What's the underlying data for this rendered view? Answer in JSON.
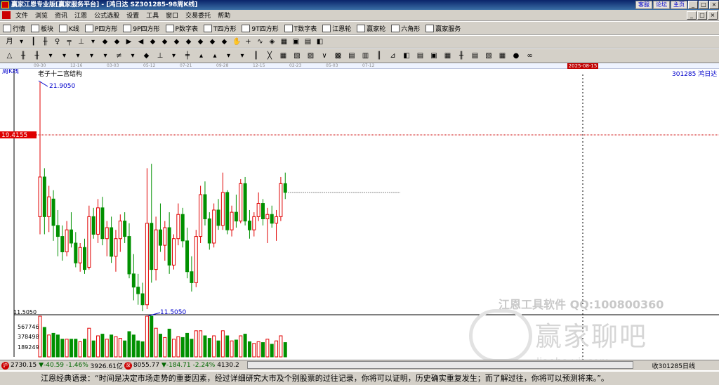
{
  "window": {
    "title": "赢家江恩专业版[赢家服务平台] - [鸿日达  SZ301285-98周K线]",
    "links": [
      "客服",
      "论坛",
      "主页"
    ],
    "controls": [
      "_",
      "□",
      "×"
    ]
  },
  "menu": [
    "文件",
    "浏览",
    "资讯",
    "江恩",
    "公式选股",
    "设置",
    "工具",
    "窗口",
    "交易委托",
    "帮助"
  ],
  "toolbar_main": [
    {
      "label": "行情",
      "icon": "grid-icon"
    },
    {
      "label": "板块",
      "icon": "blocks-icon"
    },
    {
      "label": "K线",
      "icon": "kline-icon"
    },
    {
      "label": "P四方形",
      "icon": "square-p-icon"
    },
    {
      "label": "9P四方形",
      "icon": "square-9p-icon"
    },
    {
      "label": "P数字表",
      "icon": "table-p-icon"
    },
    {
      "label": "T四方形",
      "icon": "square-t-icon"
    },
    {
      "label": "9T四方形",
      "icon": "square-9t-icon"
    },
    {
      "label": "T数字表",
      "icon": "table-t-icon"
    },
    {
      "label": "江恩轮",
      "icon": "wheel-icon"
    },
    {
      "label": "赢家轮",
      "icon": "wheel2-icon"
    },
    {
      "label": "六角形",
      "icon": "hexagon-icon"
    },
    {
      "label": "赢家服务",
      "icon": "service-icon"
    }
  ],
  "date_axis": [
    "09-30",
    "12-16",
    "03-03",
    "05-12",
    "07-21",
    "09-28",
    "12-15",
    "02-23",
    "05-03",
    "07-12"
  ],
  "selected_date": "2025-08-15",
  "chart_label": "周K线",
  "stock_label": "301285  鸿日达",
  "structure_label": "老子十二宫结构",
  "price_high": "21.9050",
  "price_low": "11.5050",
  "price_marker": "19.4155",
  "axis_low_label": "11.5050",
  "volume_labels": [
    "567746",
    "378498",
    "189249"
  ],
  "watermark": {
    "line1": "江恩工具软件  QQ:100800360",
    "line2": "赢家聊吧",
    "line3": "liaoba.yjj.com"
  },
  "status": {
    "sh_value": "2730.15",
    "sh_change": "-40.59",
    "sh_pct": "-1.46%",
    "sh_amount": "3926.61亿",
    "sz_value": "8055.77",
    "sz_change": "-184.71",
    "sz_pct": "-2.24%",
    "sz_amount": "4130.2",
    "right_text": "收301285日线"
  },
  "footer_text": "江恩经典语录：“时间是决定市场走势的重要因素，经过详细研究大市及个别股票的过往记录，你将可以证明，历史确实重复发生；而了解过往，你将可以预测将来。”。",
  "chart_data": {
    "type": "candlestick",
    "title": "周K线",
    "price_range": [
      11.505,
      21.905
    ],
    "candles_ohlc": [
      [
        15.8,
        21.905,
        15.0,
        17.6
      ],
      [
        17.6,
        18.0,
        15.0,
        15.8
      ],
      [
        15.8,
        17.2,
        15.1,
        16.7
      ],
      [
        16.6,
        17.0,
        14.7,
        15.4
      ],
      [
        15.4,
        16.1,
        14.0,
        14.9
      ],
      [
        14.9,
        15.4,
        13.8,
        14.2
      ],
      [
        14.2,
        15.6,
        14.0,
        15.2
      ],
      [
        15.2,
        16.0,
        14.4,
        14.6
      ],
      [
        14.6,
        15.1,
        13.5,
        13.7
      ],
      [
        13.7,
        14.6,
        13.3,
        14.4
      ],
      [
        14.4,
        14.8,
        13.2,
        13.4
      ],
      [
        13.5,
        16.3,
        13.4,
        15.8
      ],
      [
        15.8,
        16.2,
        14.8,
        15.0
      ],
      [
        15.0,
        16.6,
        14.6,
        16.2
      ],
      [
        16.2,
        16.7,
        14.5,
        14.8
      ],
      [
        14.8,
        15.6,
        14.0,
        15.3
      ],
      [
        15.3,
        15.8,
        13.7,
        14.0
      ],
      [
        14.0,
        15.2,
        13.3,
        14.8
      ],
      [
        14.8,
        15.9,
        14.2,
        15.6
      ],
      [
        15.6,
        16.0,
        14.6,
        14.9
      ],
      [
        14.9,
        15.5,
        13.0,
        13.2
      ],
      [
        13.2,
        14.1,
        12.0,
        12.6
      ],
      [
        12.6,
        13.2,
        11.8,
        12.3
      ],
      [
        12.3,
        12.8,
        11.505,
        11.8
      ],
      [
        11.8,
        18.0,
        11.6,
        15.5
      ],
      [
        15.5,
        18.2,
        12.8,
        13.4
      ],
      [
        13.4,
        15.8,
        12.9,
        15.2
      ],
      [
        15.2,
        16.4,
        14.2,
        14.5
      ],
      [
        14.5,
        15.6,
        13.8,
        15.3
      ],
      [
        15.3,
        16.0,
        13.2,
        13.6
      ],
      [
        13.6,
        15.0,
        13.4,
        14.8
      ],
      [
        14.8,
        16.4,
        14.5,
        15.9
      ],
      [
        15.9,
        16.2,
        14.4,
        14.7
      ],
      [
        14.7,
        15.3,
        13.0,
        13.3
      ],
      [
        13.3,
        14.0,
        12.4,
        12.8
      ],
      [
        12.8,
        15.2,
        12.6,
        14.9
      ],
      [
        14.9,
        17.2,
        14.6,
        16.8
      ],
      [
        16.8,
        17.4,
        15.4,
        15.7
      ],
      [
        15.7,
        16.0,
        14.3,
        14.6
      ],
      [
        14.6,
        16.4,
        14.4,
        16.1
      ],
      [
        16.1,
        16.6,
        15.2,
        15.4
      ],
      [
        15.4,
        17.8,
        15.2,
        16.9
      ],
      [
        16.9,
        17.0,
        15.0,
        15.2
      ],
      [
        15.2,
        16.3,
        14.9,
        16.0
      ],
      [
        16.0,
        16.8,
        15.3,
        15.6
      ],
      [
        15.6,
        17.5,
        15.5,
        17.3
      ],
      [
        17.3,
        17.6,
        15.4,
        15.6
      ],
      [
        15.6,
        16.1,
        14.8,
        15.2
      ],
      [
        15.2,
        16.0,
        14.9,
        15.8
      ],
      [
        15.8,
        16.9,
        15.6,
        16.4
      ],
      [
        16.4,
        16.6,
        15.4,
        15.7
      ],
      [
        15.7,
        16.2,
        14.6,
        15.9
      ],
      [
        15.9,
        16.3,
        15.3,
        15.5
      ],
      [
        15.5,
        16.1,
        14.7,
        15.8
      ],
      [
        15.8,
        17.6,
        15.6,
        17.3
      ],
      [
        17.3,
        17.8,
        16.6,
        16.9
      ]
    ],
    "volume_range": [
      0,
      567746
    ]
  }
}
